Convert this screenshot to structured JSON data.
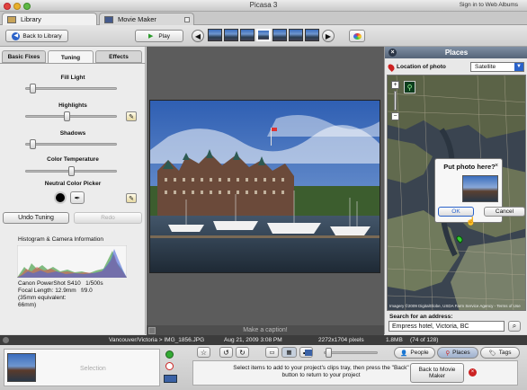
{
  "window": {
    "title": "Picasa 3",
    "signin": "Sign in to Web Albums"
  },
  "tabs": [
    {
      "label": "Library",
      "icon": "library-icon"
    },
    {
      "label": "Movie Maker",
      "icon": "film-icon"
    }
  ],
  "toolbar": {
    "back_label": "Back to Library",
    "play_label": "Play",
    "play_icon": "play-triangle-icon"
  },
  "left_panel": {
    "tabs": [
      "Basic Fixes",
      "Tuning",
      "Effects"
    ],
    "active_tab": "Tuning",
    "sliders": [
      {
        "label": "Fill Light",
        "value": 0.05
      },
      {
        "label": "Highlights",
        "value": 0.45
      },
      {
        "label": "Shadows",
        "value": 0.05
      },
      {
        "label": "Color Temperature",
        "value": 0.5
      }
    ],
    "picker_label": "Neutral Color Picker",
    "undo_label": "Undo Tuning",
    "redo_label": "Redo",
    "histogram_title": "Histogram & Camera Information",
    "camera_info": [
      "Canon PowerShot S410   1/500s",
      "Focal Length: 12.9mm   f/9.0",
      "(35mm equivalent:",
      "66mm)"
    ]
  },
  "caption": {
    "placeholder": "Make a caption!"
  },
  "places": {
    "title": "Places",
    "location_label": "Location of photo",
    "map_type": "Satellite",
    "popup_title": "Put photo here?",
    "ok_label": "OK",
    "cancel_label": "Cancel",
    "attribution": "Imagery ©2009 DigitalGlobe, USDA Farm Service Agency - Terms of Use",
    "search_label": "Search for an address:",
    "search_value": "Empress hotel, Victoria, BC"
  },
  "status": {
    "path": "Vancouver/Victoria > IMG_1856.JPG",
    "date": "Aug 21, 2009 3:08 PM",
    "dims": "2272x1704 pixels",
    "size": "1.8MB",
    "count": "(74 of 128)"
  },
  "bottom": {
    "selection_label": "Selection",
    "message": "Select items to add to your project's clips tray, then press the \"Back\" button to return to your project",
    "back_movie_label": "Back to Movie Maker",
    "people_label": "People",
    "places_label": "Places",
    "tags_label": "Tags"
  },
  "colors": {
    "accent": "#2a62c9",
    "places_header": "#667891",
    "status_bg": "#3c3c3c"
  }
}
